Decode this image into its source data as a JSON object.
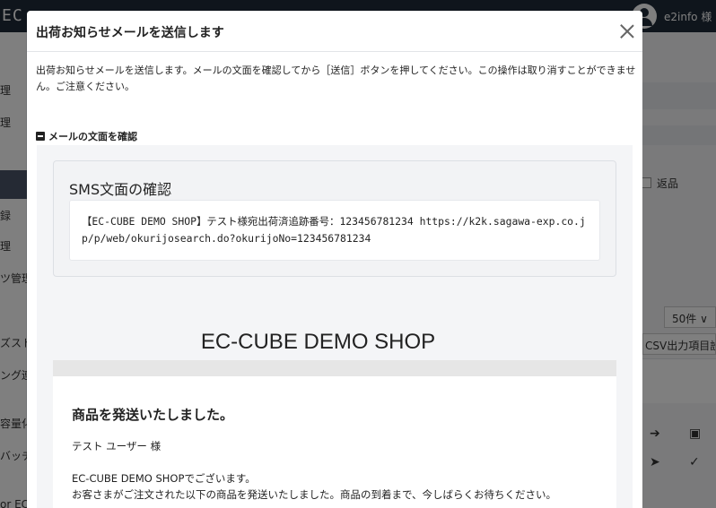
{
  "background": {
    "logo": "EC",
    "user_name": "e2info 様",
    "sidebar_items": [
      "理",
      "理",
      "録",
      "理",
      "ツ管理",
      "ズスト",
      "ング連",
      "容量化",
      "バッチ",
      "or EC"
    ],
    "return_label": "返品",
    "per_page": "50件 ∨",
    "csv_button": "CSV出力項目設定"
  },
  "modal": {
    "title": "出荷お知らせメールを送信します",
    "description": "出荷お知らせメールを送信します。メールの文面を確認してから［送信］ボタンを押してください。この操作は取り消すことができません。ご注意ください。",
    "toggle_label": "メールの文面を確認",
    "sms": {
      "title": "SMS文面の確認",
      "text": "【EC-CUBE DEMO SHOP】テスト様宛出荷済追跡番号：123456781234 https://k2k.sagawa-exp.co.jp/p/web/okurijosearch.do?okurijoNo=123456781234"
    },
    "mail": {
      "shop_name": "EC-CUBE DEMO SHOP",
      "heading": "商品を発送いたしました。",
      "recipient": "テスト ユーザー 様",
      "line1": "EC-CUBE DEMO SHOPでございます。",
      "line2": "お客さまがご注文された以下の商品を発送いたしました。商品の到着まで、今しばらくお待ちください。"
    }
  }
}
